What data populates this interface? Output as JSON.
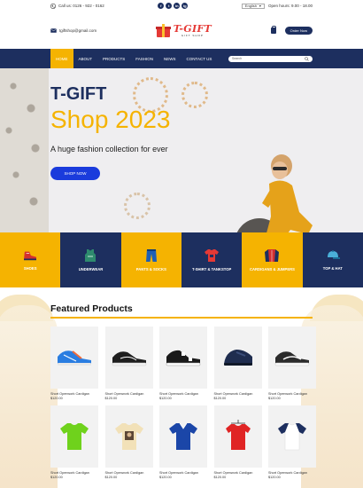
{
  "topbar": {
    "phone": "Call us: 0126 - 922 - 0162",
    "language": "English",
    "hours": "Open hours: 9.00 - 18.00",
    "socials": [
      "f",
      "t",
      "in",
      "ig"
    ]
  },
  "header": {
    "email": "tgiftshop@gmail.com",
    "logo_title": "T-GIFT",
    "logo_subtitle": "GIFT SHOP",
    "order_button": "Order Now"
  },
  "nav": {
    "items": [
      "HOME",
      "ABOUT",
      "PRODUCTS",
      "FASHION",
      "NEWS",
      "CONTACT US"
    ],
    "active_index": 0,
    "search_placeholder": "Search"
  },
  "hero": {
    "title_line1": "T-GIFT",
    "title_line2": "Shop 2023",
    "tagline": "A huge fashion collection for ever",
    "cta": "SHOP NOW"
  },
  "categories": [
    {
      "label": "SHOES",
      "icon": "sneaker-icon",
      "color": "yellow"
    },
    {
      "label": "UNDERWEAR",
      "icon": "tank-top-icon",
      "color": "navy"
    },
    {
      "label": "PANTS & SOCKS",
      "icon": "pants-icon",
      "color": "yellow"
    },
    {
      "label": "T-SHIRT & TANKSTOP",
      "icon": "tshirt-icon",
      "color": "navy"
    },
    {
      "label": "CARDIGANS & JUMPERS",
      "icon": "cardigan-icon",
      "color": "yellow"
    },
    {
      "label": "TOP & HAT",
      "icon": "cap-icon",
      "color": "navy"
    }
  ],
  "featured": {
    "heading": "Featured Products",
    "products": [
      {
        "name": "Short Openwork Cardigan",
        "price": "$120.00",
        "icon": "blue-sneaker-icon"
      },
      {
        "name": "Short Openwork Cardigan",
        "price": "$120.00",
        "icon": "black-sneaker-icon"
      },
      {
        "name": "Short Openwork Cardigan",
        "price": "$120.00",
        "icon": "checkered-sneaker-icon"
      },
      {
        "name": "Short Openwork Cardigan",
        "price": "$120.00",
        "icon": "loafer-icon"
      },
      {
        "name": "Short Openwork Cardigan",
        "price": "$120.00",
        "icon": "running-shoe-icon"
      },
      {
        "name": "Short Openwork Cardigan",
        "price": "$120.00",
        "icon": "green-tshirt-icon"
      },
      {
        "name": "Short Openwork Cardigan",
        "price": "$120.00",
        "icon": "print-tshirt-icon"
      },
      {
        "name": "Short Openwork Cardigan",
        "price": "$120.00",
        "icon": "polo-shirt-icon"
      },
      {
        "name": "Short Openwork Cardigan",
        "price": "$120.00",
        "icon": "red-tshirt-icon"
      },
      {
        "name": "Short Openwork Cardigan",
        "price": "$120.00",
        "icon": "raglan-tshirt-icon"
      }
    ]
  },
  "colors": {
    "navy": "#1d2f5f",
    "yellow": "#f5b301",
    "button_blue": "#1a3bdc",
    "brand_red": "#e53935"
  }
}
